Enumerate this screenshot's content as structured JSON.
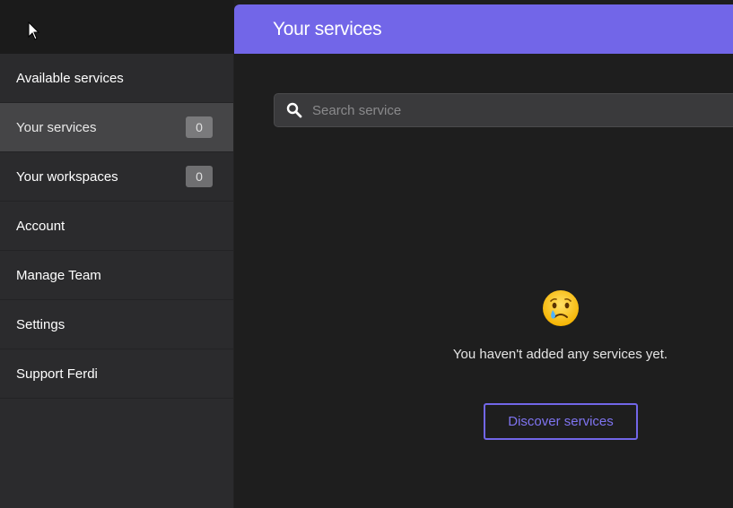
{
  "sidebar": {
    "items": [
      {
        "label": "Available services"
      },
      {
        "label": "Your services",
        "count": "0"
      },
      {
        "label": "Your workspaces",
        "count": "0"
      },
      {
        "label": "Account"
      },
      {
        "label": "Manage Team"
      },
      {
        "label": "Settings"
      },
      {
        "label": "Support Ferdi"
      }
    ]
  },
  "header": {
    "title": "Your services"
  },
  "search": {
    "placeholder": "Search service",
    "value": ""
  },
  "empty_state": {
    "emoji": "crying-face",
    "message": "You haven't added any services yet.",
    "button_label": "Discover services"
  },
  "colors": {
    "accent": "#7266e8",
    "sidebar_bg": "#2b2b2d",
    "active_item_bg": "#454547",
    "content_bg": "#1e1e1e"
  }
}
